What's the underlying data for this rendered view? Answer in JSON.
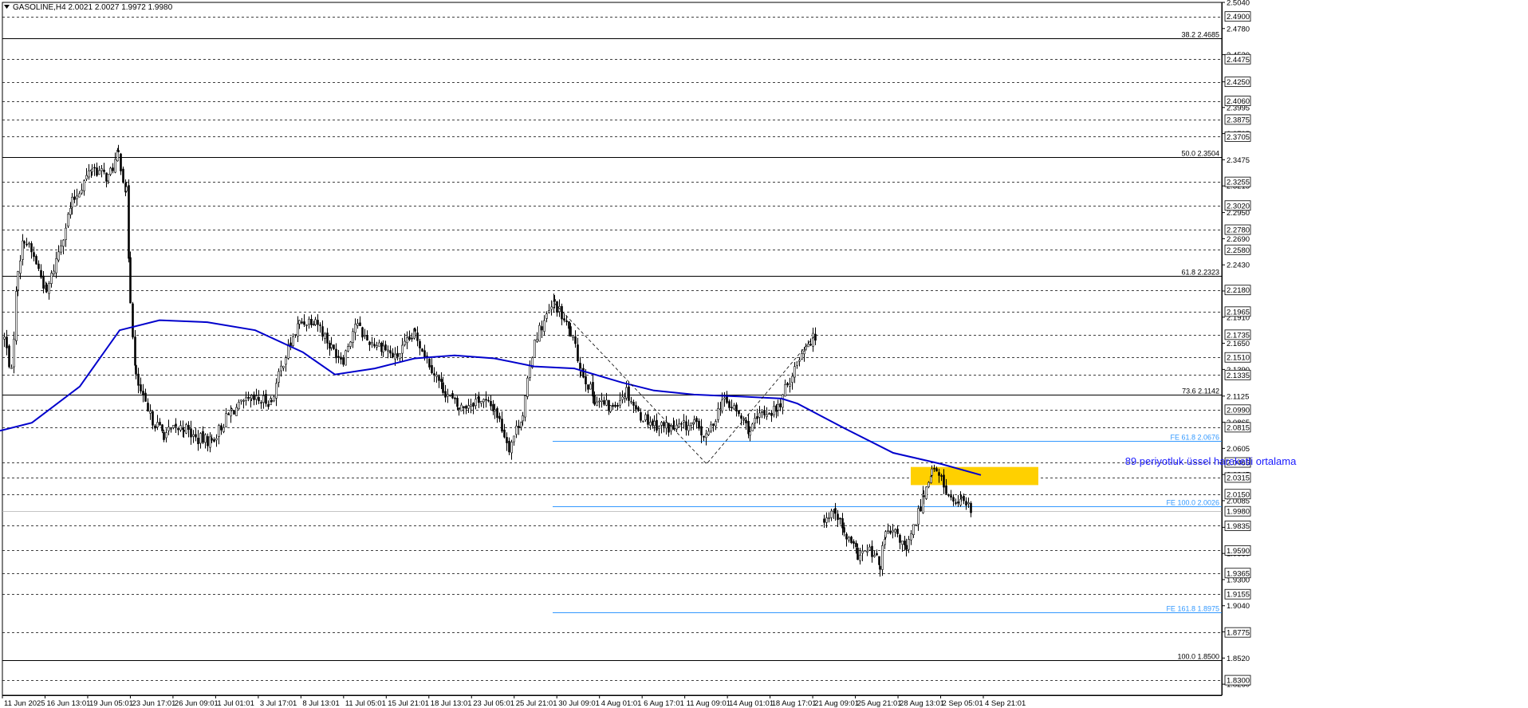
{
  "chart_data": {
    "type": "candlestick",
    "title": "GASOLINE,H4  2.0021 2.0027 1.9972 1.9980",
    "symbol": "GASOLINE,H4",
    "ohlc_header": {
      "open": 2.0021,
      "high": 2.0027,
      "low": 1.9972,
      "close": 1.998
    },
    "ylim": [
      1.815,
      2.504
    ],
    "grid": false,
    "price_ticks": [
      2.504,
      2.478,
      2.452,
      2.425,
      2.3995,
      2.3735,
      2.3475,
      2.3215,
      2.295,
      2.269,
      2.243,
      2.217,
      2.191,
      2.165,
      2.139,
      2.1125,
      2.0865,
      2.0605,
      2.0345,
      2.0085,
      1.982,
      1.956,
      1.93,
      1.904,
      1.878,
      1.852,
      1.826
    ],
    "x_ticks": [
      "11 Jun 2025",
      "16 Jun 13:01",
      "19 Jun 05:01",
      "23 Jun 17:01",
      "26 Jun 09:01",
      "1 Jul 01:01",
      "3 Jul 17:01",
      "8 Jul 13:01",
      "11 Jul 05:01",
      "15 Jul 21:01",
      "18 Jul 13:01",
      "23 Jul 05:01",
      "25 Jul 21:01",
      "30 Jul 09:01",
      "4 Aug 01:01",
      "6 Aug 17:01",
      "11 Aug 09:01",
      "14 Aug 01:01",
      "18 Aug 17:01",
      "21 Aug 09:01",
      "25 Aug 21:01",
      "28 Aug 13:01",
      "2 Sep 05:01",
      "4 Sep 21:01"
    ],
    "horizontal_levels": [
      2.49,
      2.4475,
      2.425,
      2.406,
      2.3875,
      2.3705,
      2.3255,
      2.302,
      2.278,
      2.258,
      2.218,
      2.1965,
      2.1735,
      2.151,
      2.1335,
      2.099,
      2.0815,
      2.0465,
      2.0315,
      2.015,
      1.9835,
      1.959,
      1.9365,
      1.9155,
      1.8775,
      1.83
    ],
    "fibonacci_levels": [
      {
        "label": "38.2 2.4685",
        "value": 2.4685
      },
      {
        "label": "50.0 2.3504",
        "value": 2.3504
      },
      {
        "label": "61.8 2.2323",
        "value": 2.2323
      },
      {
        "label": "73.6 2.1142",
        "value": 2.1142
      },
      {
        "label": "100.0 1.8500",
        "value": 1.85
      }
    ],
    "fibonacci_expansion_levels": [
      {
        "label": "FE 61.8 2.0676",
        "value": 2.0676
      },
      {
        "label": "FE 100.0 2.0026",
        "value": 2.0026
      },
      {
        "label": "FE 161.8 1.8975",
        "value": 1.8975
      }
    ],
    "current_price": 1.998,
    "current_price_label": "1.9980",
    "annotation": "89 periyotluk üssel hareketli ortalama",
    "highlight_zone": {
      "from": 2.024,
      "to": 2.042
    },
    "moving_average": {
      "period": 89,
      "type": "exponential",
      "color": "#0000cc",
      "x": [
        0,
        40,
        100,
        150,
        200,
        260,
        320,
        380,
        420,
        470,
        520,
        570,
        620,
        670,
        720,
        780,
        820,
        870,
        930,
        980,
        1000,
        1060,
        1120,
        1180,
        1230
      ],
      "values": [
        2.078,
        2.086,
        2.122,
        2.178,
        2.188,
        2.186,
        2.178,
        2.156,
        2.134,
        2.14,
        2.15,
        2.153,
        2.15,
        2.142,
        2.14,
        2.126,
        2.118,
        2.114,
        2.112,
        2.11,
        2.105,
        2.08,
        2.056,
        2.045,
        2.034
      ]
    },
    "colors": {
      "candle": "#000000",
      "grid_line": "#000000",
      "fib_line": "#000000",
      "fe_line": "#3399ff",
      "moving_average": "#0000cc",
      "highlight_zone": "#ffd000",
      "annotation": "#1a1aff",
      "label_box": "#ffffff",
      "current_price_line": "#b0b0b0"
    }
  }
}
